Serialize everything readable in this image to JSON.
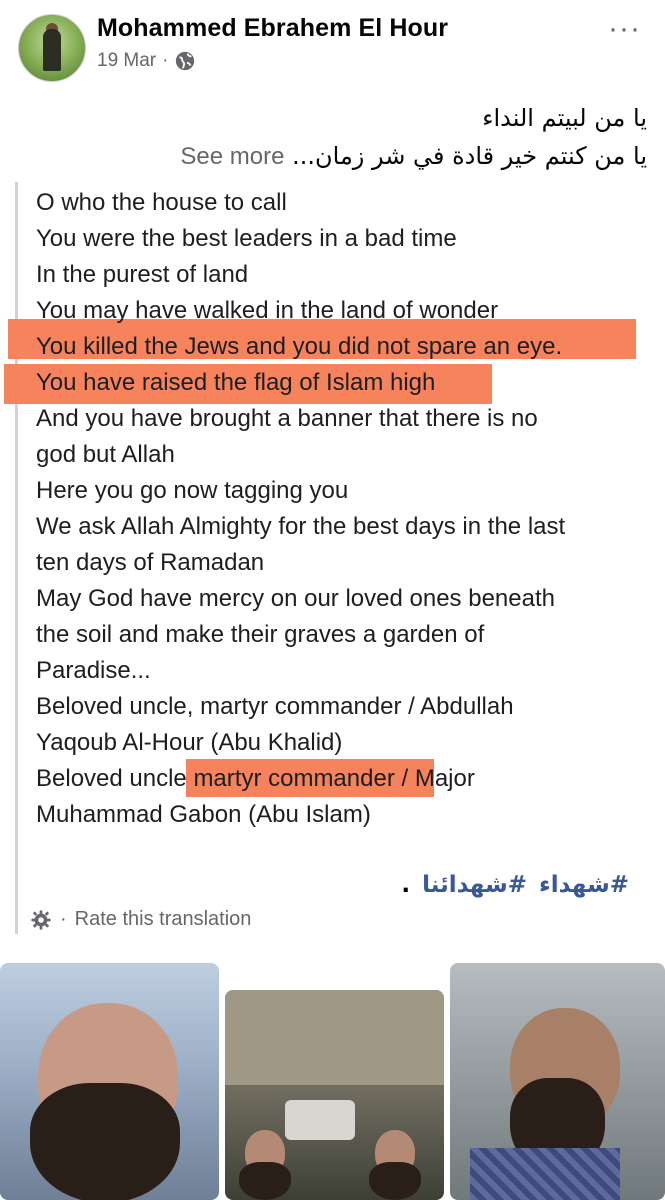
{
  "post": {
    "author": "Mohammed Ebrahem El Hour",
    "date": "19 Mar",
    "separator": "·",
    "more_icon": "···",
    "arabic_line1": "يا من لبيتم النداء",
    "arabic_line2": "يا من كنتم خير قادة في شر زمان...",
    "see_more": "See more",
    "translation_lines": [
      "O who the house to call",
      "You were the best leaders in a bad time",
      "In the purest of land",
      "You may have walked in the land of wonder",
      "You killed the Jews and you did not spare an eye.",
      "You have raised the flag of Islam high",
      "And you have brought a banner that there is no",
      "god but Allah",
      "Here you go now tagging you",
      "We ask Allah Almighty for the best days in the last",
      "ten days of Ramadan",
      "May God have mercy on our loved ones beneath",
      "the soil and make their graves a garden of",
      "Paradise...",
      "Beloved uncle, martyr commander / Abdullah",
      "Yaqoub Al-Hour (Abu Khalid)",
      "Beloved uncle martyr commander / Major",
      "Muhammad Gabon (Abu Islam)"
    ],
    "hashtag1": "#شهداء",
    "hashtag2": "#شهدائنا",
    "hashtag_end": ".",
    "rate_label": "Rate this translation",
    "rate_sep": "·",
    "highlight_color": "#f7835c",
    "link_color": "#385898"
  }
}
